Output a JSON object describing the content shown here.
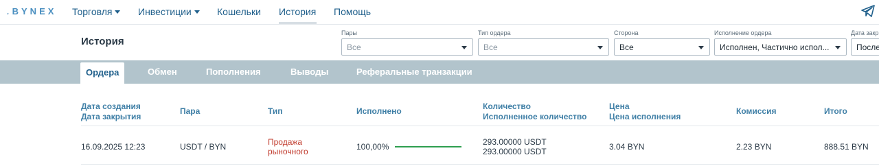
{
  "brand": {
    "logo": "BYNEX"
  },
  "nav": {
    "items": [
      {
        "label": "Торговля",
        "dropdown": true
      },
      {
        "label": "Инвестиции",
        "dropdown": true
      },
      {
        "label": "Кошельки",
        "dropdown": false
      },
      {
        "label": "История",
        "dropdown": false,
        "active": true
      },
      {
        "label": "Помощь",
        "dropdown": false
      }
    ],
    "telegram_icon": "telegram-send-icon"
  },
  "page": {
    "title": "История"
  },
  "filters": [
    {
      "label": "Пары",
      "value": "Все"
    },
    {
      "label": "Тип ордера",
      "value": "Все"
    },
    {
      "label": "Сторона",
      "value": "Все"
    },
    {
      "label": "Исполнение ордера",
      "value": "Исполнен, Частично испол..."
    },
    {
      "label": "Дата закрытия",
      "value": "После"
    }
  ],
  "tabs": [
    {
      "label": "Ордера",
      "active": true
    },
    {
      "label": "Обмен"
    },
    {
      "label": "Пополнения"
    },
    {
      "label": "Выводы"
    },
    {
      "label": "Реферальные транзакции"
    }
  ],
  "table": {
    "headers": {
      "date_created": "Дата создания",
      "date_closed": "Дата закрытия",
      "pair": "Пара",
      "type": "Тип",
      "filled": "Исполнено",
      "quantity": "Количество",
      "quantity_filled": "Исполненное количество",
      "price": "Цена",
      "price_filled": "Цена исполнения",
      "fee": "Комиссия",
      "total": "Итого"
    },
    "rows": [
      {
        "date": "16.09.2025 12:23",
        "pair": "USDT / BYN",
        "type_line1": "Продажа",
        "type_line2": "рыночного",
        "filled": "100,00%",
        "filled_fraction": 1.0,
        "quantity": "293.00000 USDT",
        "quantity_filled": "293.00000 USDT",
        "price": "3.04 BYN",
        "fee": "2.23 BYN",
        "total": "888.51 BYN"
      }
    ]
  },
  "colors": {
    "accent": "#1f5f8b",
    "tabs_bar": "#b2c4cc",
    "sell": "#c0392b",
    "progress": "#2e9e4f"
  }
}
